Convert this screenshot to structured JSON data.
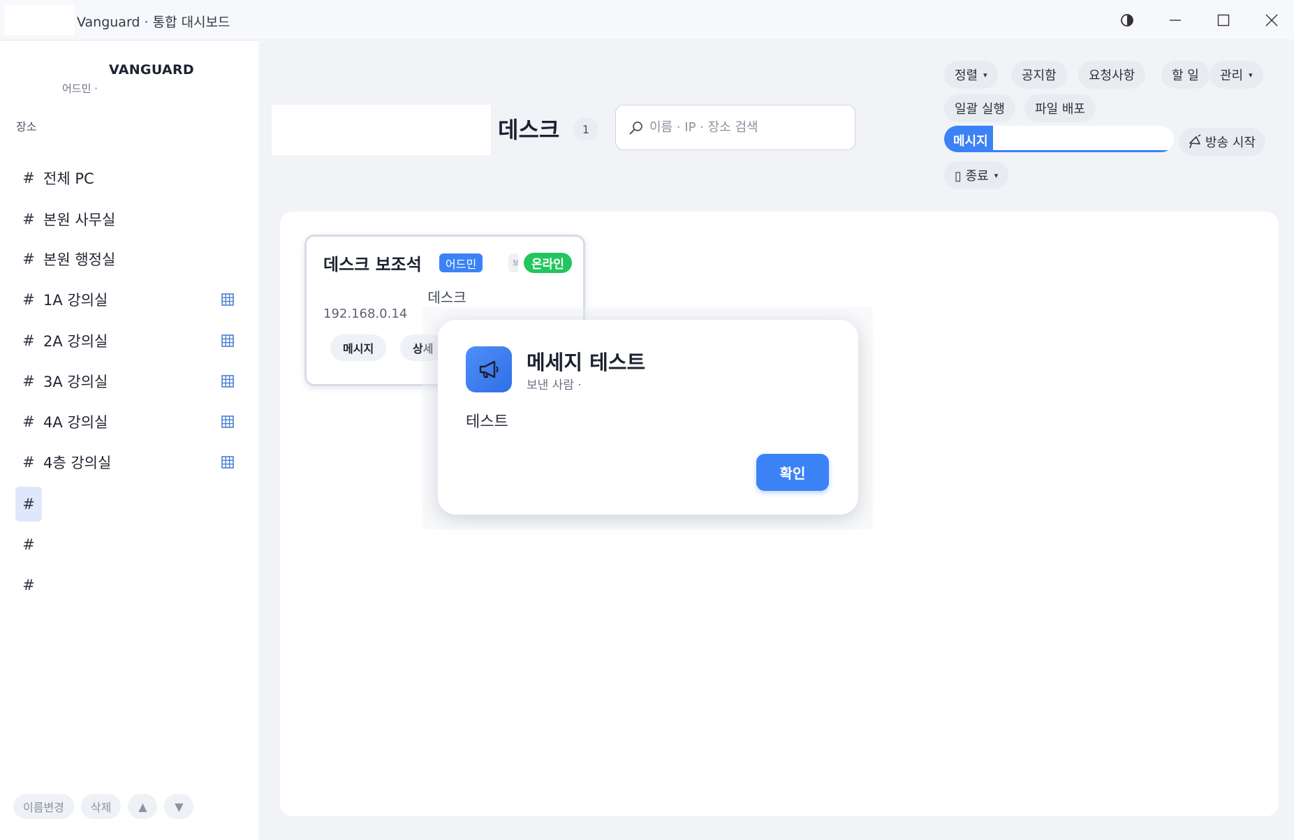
{
  "window": {
    "title": "Vanguard · 통합 대시보드"
  },
  "sidebar": {
    "brand": "VANGUARD",
    "brand_sub": "어드민 ·",
    "section_label": "장소",
    "items": [
      {
        "label": "전체 PC",
        "has_grid": false
      },
      {
        "label": "본원 사무실",
        "has_grid": false
      },
      {
        "label": "본원 행정실",
        "has_grid": false
      },
      {
        "label": "1A 강의실",
        "has_grid": true
      },
      {
        "label": "2A 강의실",
        "has_grid": true
      },
      {
        "label": "3A 강의실",
        "has_grid": true
      },
      {
        "label": "4A 강의실",
        "has_grid": true
      },
      {
        "label": "4층 강의실",
        "has_grid": true
      },
      {
        "label": "",
        "has_grid": false,
        "active": true
      },
      {
        "label": "",
        "has_grid": false
      },
      {
        "label": "",
        "has_grid": false
      }
    ],
    "hash": "#",
    "footer": {
      "rename": "이름변경",
      "delete": "삭제",
      "up": "▲",
      "down": "▼"
    }
  },
  "header": {
    "title": "데스크",
    "count": "1",
    "search_placeholder": "이름 · IP · 장소 검색"
  },
  "toolbar": {
    "sort": "정렬",
    "notices": "공지함",
    "requests": "요청사항",
    "todo": "할 일",
    "manage": "관리",
    "batch_run": "일괄 실행",
    "file_deploy": "파일 배포",
    "message_label": "메시지",
    "message_value": "",
    "broadcast": "방송 시작",
    "shutdown": "▯ 종료",
    "caret": "▾"
  },
  "device_card": {
    "name": "데스크 보조석",
    "badge_admin": "어드민",
    "badge_hidden": "보",
    "status": "온라인",
    "location": "데스크",
    "ip": "192.168.0.14",
    "btn_message": "메시지",
    "btn_detail": "상세"
  },
  "modal": {
    "title": "메세지 테스트",
    "sender": "보낸 사람 ·",
    "body": "테스트",
    "confirm": "확인"
  },
  "colors": {
    "accent": "#3b82f6",
    "online": "#22c55e",
    "main_bg": "#f1f3f7"
  }
}
